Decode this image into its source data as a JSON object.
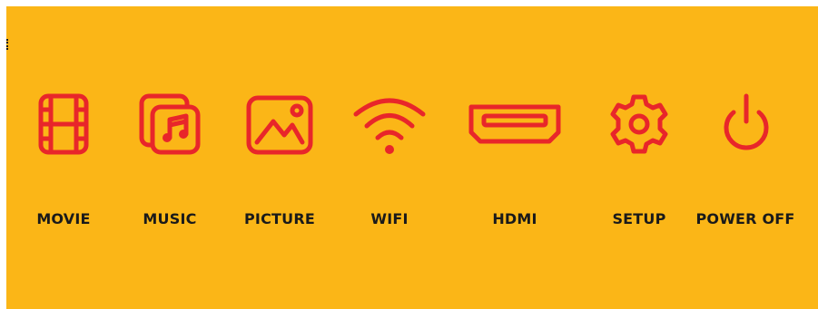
{
  "colors": {
    "background": "#FBB617",
    "icon": "#E8262A",
    "label": "#1a1a1a"
  },
  "menu": [
    {
      "label": "MOVIE",
      "icon": "film-strip-icon"
    },
    {
      "label": "MUSIC",
      "icon": "music-library-icon"
    },
    {
      "label": "PICTURE",
      "icon": "picture-icon"
    },
    {
      "label": "WIFI",
      "icon": "wifi-icon"
    },
    {
      "label": "HDMI",
      "icon": "hdmi-port-icon"
    },
    {
      "label": "SETUP",
      "icon": "gear-icon"
    },
    {
      "label": "POWER OFF",
      "icon": "power-icon"
    }
  ]
}
